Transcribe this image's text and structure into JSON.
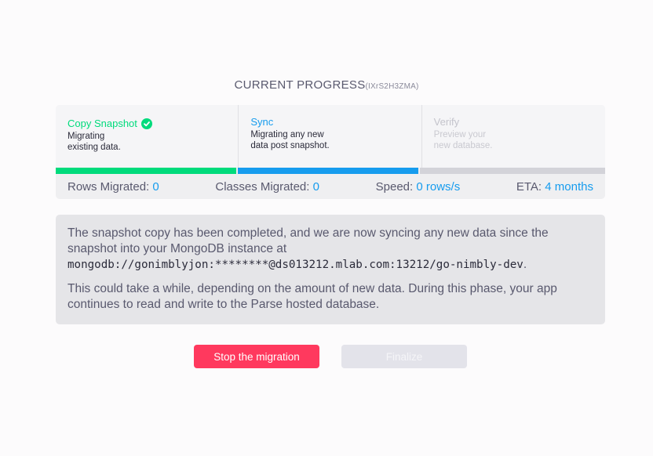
{
  "header": {
    "title": "CURRENT PROGRESS",
    "code": "(IXrS2H3ZMA)"
  },
  "steps": [
    {
      "title": "Copy Snapshot",
      "desc1": "Migrating",
      "desc2": "existing data.",
      "status": "done"
    },
    {
      "title": "Sync",
      "desc1": "Migrating any new",
      "desc2": "data post snapshot.",
      "status": "active"
    },
    {
      "title": "Verify",
      "desc1": "Preview your",
      "desc2": "new database.",
      "status": "pending"
    }
  ],
  "stats": {
    "rows_label": "Rows Migrated:",
    "rows_value": "0",
    "classes_label": "Classes Migrated:",
    "classes_value": "0",
    "speed_label": "Speed:",
    "speed_value": "0 rows/s",
    "eta_label": "ETA:",
    "eta_value": "4 months"
  },
  "info": {
    "para1_text": "The snapshot copy has been completed, and we are now syncing any new data since the snapshot into your MongoDB instance at",
    "connection_string": "mongodb://gonimblyjon:********@ds013212.mlab.com:13212/go-nimbly-dev",
    "para1_end": ".",
    "para2": "This could take a while, depending on the amount of new data. During this phase, your app continues to read and write to the Parse hosted database."
  },
  "buttons": {
    "stop": "Stop the migration",
    "finalize": "Finalize"
  },
  "colors": {
    "done": "#00db7c",
    "active": "#169cee",
    "danger": "#ff395e"
  }
}
